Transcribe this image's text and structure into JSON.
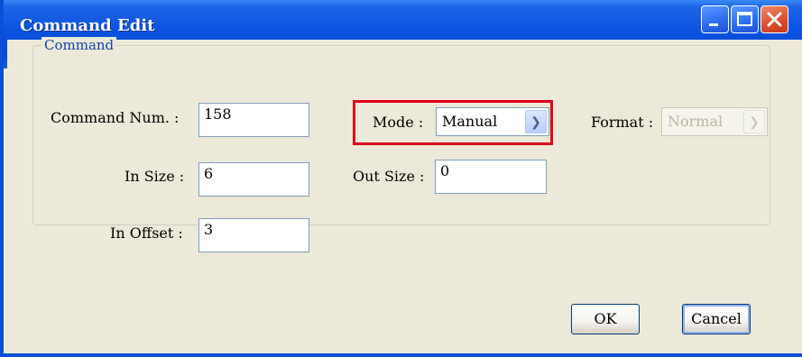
{
  "window": {
    "title": "Command Edit"
  },
  "group": {
    "legend": "Command"
  },
  "fields": {
    "command_num": {
      "label": "Command Num. :",
      "value": "158"
    },
    "in_size": {
      "label": "In Size :",
      "value": "6"
    },
    "in_offset": {
      "label": "In Offset :",
      "value": "3"
    },
    "mode": {
      "label": "Mode :",
      "value": "Manual"
    },
    "out_size": {
      "label": "Out Size :",
      "value": "0"
    },
    "format": {
      "label": "Format :",
      "value": "Normal",
      "disabled": true
    }
  },
  "buttons": {
    "ok": "OK",
    "cancel": "Cancel"
  },
  "colors": {
    "titlebar": "#0a52e0",
    "highlight": "#e0001a",
    "legend": "#1046a8"
  }
}
